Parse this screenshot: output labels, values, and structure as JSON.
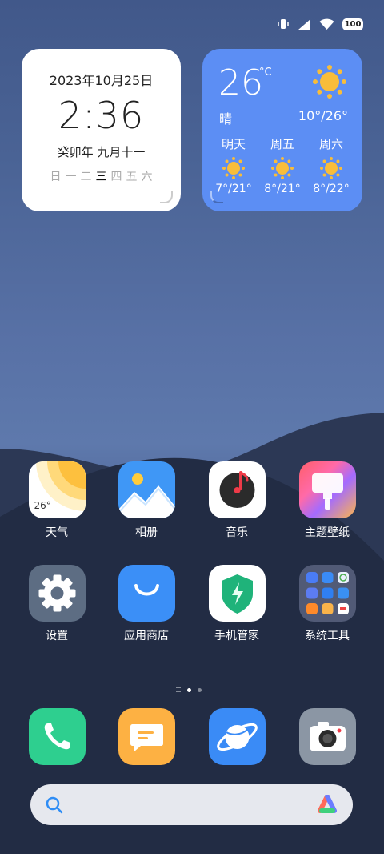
{
  "status_bar": {
    "battery": "100",
    "icons": [
      "vibrate-icon",
      "signal-icon",
      "wifi-icon",
      "battery-icon"
    ]
  },
  "clock_widget": {
    "date": "2023年10月25日",
    "time": "2:36",
    "lunar": "癸卯年 九月十一",
    "weekdays": [
      "日",
      "一",
      "二",
      "三",
      "四",
      "五",
      "六"
    ],
    "current_weekday": "三"
  },
  "weather_widget": {
    "temp": "26",
    "unit": "°C",
    "condition": "晴",
    "range": "10°/26°",
    "forecast": [
      {
        "day": "明天",
        "temp": "7°/21°"
      },
      {
        "day": "周五",
        "temp": "8°/21°"
      },
      {
        "day": "周六",
        "temp": "8°/22°"
      }
    ]
  },
  "apps": {
    "weather": {
      "label": "天气",
      "badge": "26°"
    },
    "gallery": {
      "label": "相册"
    },
    "music": {
      "label": "音乐"
    },
    "themes": {
      "label": "主题壁纸"
    },
    "settings": {
      "label": "设置"
    },
    "appstore": {
      "label": "应用商店"
    },
    "security": {
      "label": "手机管家"
    },
    "tools": {
      "label": "系统工具"
    }
  },
  "dock": [
    "phone",
    "messages",
    "browser",
    "camera"
  ],
  "search": {
    "placeholder": ""
  },
  "colors": {
    "weather_widget_bg": "#5c8ef4",
    "sun": "#f8bd3a",
    "phone_green": "#2ecf8f",
    "messages_orange": "#fdb143",
    "browser_blue": "#3a8bf6",
    "appstore_blue": "#3b8ff7",
    "security_green": "#1fb37a"
  }
}
